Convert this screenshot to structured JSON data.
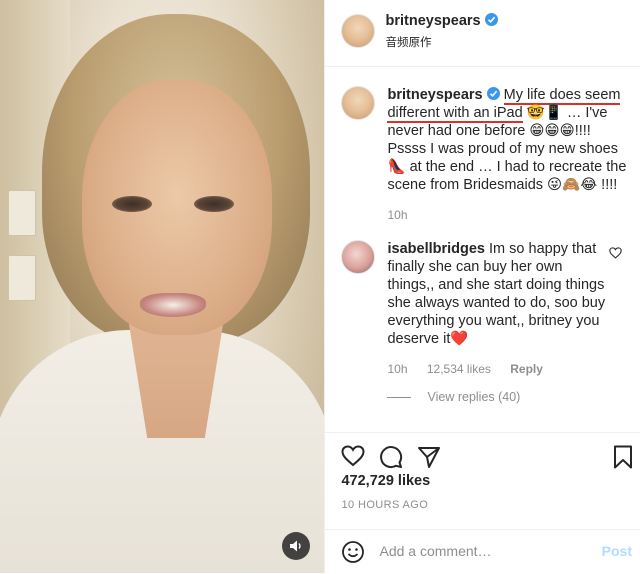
{
  "post": {
    "author": "britneyspears",
    "subtitle": "音频原作",
    "caption_underlined": "My life does seem different with an iPad",
    "caption_emoji_1": "🤓📱",
    "caption_rest": "… I've never had one before 😁😁😁!!!! Pssss I was proud of my new shoes 👠 at the end … I had to recreate the scene from Bridesmaids 😜🙈😂 !!!!",
    "caption_time": "10h",
    "like_count": "472,729 likes",
    "timestamp": "10 HOURS AGO"
  },
  "comment": {
    "author": "isabellbridges",
    "text": "Im so happy that finally she can buy her own things,, and she start doing things she always wanted to do, soo buy everything you want,, britney you deserve it❤️",
    "time": "10h",
    "likes": "12,534 likes",
    "reply_label": "Reply",
    "view_replies": "View replies (40)"
  },
  "composer": {
    "placeholder": "Add a comment…",
    "post_label": "Post"
  },
  "icons": {
    "verified": "verified-badge-icon",
    "like": "heart-icon",
    "comment": "comment-icon",
    "share": "paper-plane-icon",
    "save": "bookmark-icon",
    "emoji": "smiley-icon",
    "sound": "speaker-icon"
  },
  "colors": {
    "verified": "#3897f0",
    "annotation_underline": "#d9302c",
    "post_disabled": "#b3dbff",
    "secondary_text": "#8e8e8e"
  }
}
